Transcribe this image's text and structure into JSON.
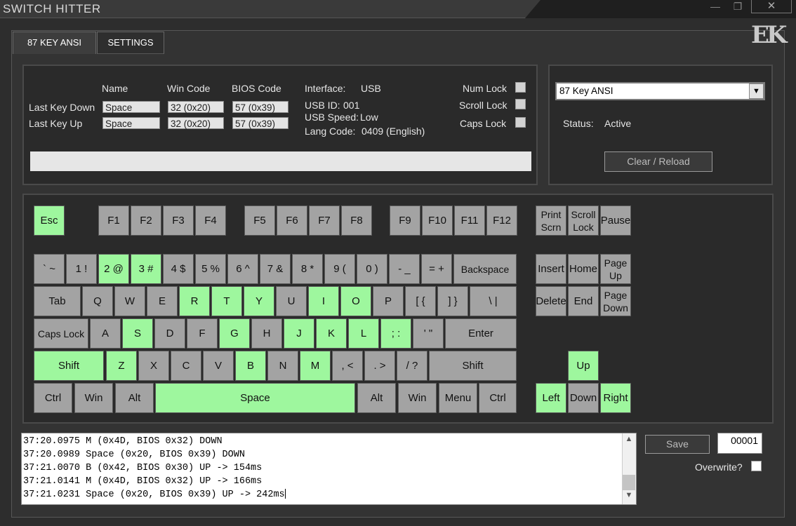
{
  "window": {
    "title": "SWITCH HITTER",
    "min": "—",
    "max": "❐",
    "close": "✕",
    "logo": "EK"
  },
  "tabs": [
    "87 KEY ANSI",
    "SETTINGS"
  ],
  "info": {
    "headers": {
      "name": "Name",
      "win": "Win Code",
      "bios": "BIOS Code"
    },
    "rows": [
      {
        "label": "Last Key Down",
        "name": "Space",
        "win": "32 (0x20)",
        "bios": "57 (0x39)"
      },
      {
        "label": "Last Key Up",
        "name": "Space",
        "win": "32 (0x20)",
        "bios": "57 (0x39)"
      }
    ],
    "interface_label": "Interface:",
    "interface_value": "USB",
    "usb_id_label": "USB ID:",
    "usb_id_value": "001",
    "usb_speed_label": "USB Speed:",
    "usb_speed_value": "Low",
    "lang_label": "Lang Code:",
    "lang_value": "0409 (English)",
    "locks": [
      "Num Lock",
      "Scroll Lock",
      "Caps Lock"
    ]
  },
  "right": {
    "select_value": "87 Key ANSI",
    "select_arrow": "▼",
    "status_label": "Status:",
    "status_value": "Active",
    "reload_button": "Clear / Reload"
  },
  "colors": {
    "key_default": "#a3a3a3",
    "key_pressed": "#9ef79e",
    "background": "#2d2d2d"
  },
  "keys": [
    {
      "label": "Esc",
      "on": true
    },
    {
      "label": "F1"
    },
    {
      "label": "F2"
    },
    {
      "label": "F3"
    },
    {
      "label": "F4"
    },
    {
      "label": "F5"
    },
    {
      "label": "F6"
    },
    {
      "label": "F7"
    },
    {
      "label": "F8"
    },
    {
      "label": "F9"
    },
    {
      "label": "F10"
    },
    {
      "label": "F11"
    },
    {
      "label": "F12"
    },
    {
      "label": "Print\nScrn"
    },
    {
      "label": "Scroll\nLock"
    },
    {
      "label": "Pause"
    },
    {
      "label": "` ~"
    },
    {
      "label": "1 !"
    },
    {
      "label": "2 @",
      "on": true
    },
    {
      "label": "3 #",
      "on": true
    },
    {
      "label": "4 $"
    },
    {
      "label": "5 %"
    },
    {
      "label": "6 ^"
    },
    {
      "label": "7 &"
    },
    {
      "label": "8 *"
    },
    {
      "label": "9 ("
    },
    {
      "label": "0 )"
    },
    {
      "label": "- _"
    },
    {
      "label": "= +"
    },
    {
      "label": "Backspace"
    },
    {
      "label": "Insert"
    },
    {
      "label": "Home"
    },
    {
      "label": "Page\nUp"
    },
    {
      "label": "Tab"
    },
    {
      "label": "Q"
    },
    {
      "label": "W"
    },
    {
      "label": "E"
    },
    {
      "label": "R",
      "on": true
    },
    {
      "label": "T",
      "on": true
    },
    {
      "label": "Y",
      "on": true
    },
    {
      "label": "U"
    },
    {
      "label": "I",
      "on": true
    },
    {
      "label": "O",
      "on": true
    },
    {
      "label": "P"
    },
    {
      "label": "[ {"
    },
    {
      "label": "] }"
    },
    {
      "label": "\\ |"
    },
    {
      "label": "Delete"
    },
    {
      "label": "End"
    },
    {
      "label": "Page\nDown"
    },
    {
      "label": "Caps Lock"
    },
    {
      "label": "A"
    },
    {
      "label": "S",
      "on": true
    },
    {
      "label": "D"
    },
    {
      "label": "F"
    },
    {
      "label": "G",
      "on": true
    },
    {
      "label": "H"
    },
    {
      "label": "J",
      "on": true
    },
    {
      "label": "K",
      "on": true
    },
    {
      "label": "L",
      "on": true
    },
    {
      "label": "; :",
      "on": true
    },
    {
      "label": "' \""
    },
    {
      "label": "Enter"
    },
    {
      "label": "Shift",
      "on": true
    },
    {
      "label": "Z",
      "on": true
    },
    {
      "label": "X"
    },
    {
      "label": "C"
    },
    {
      "label": "V"
    },
    {
      "label": "B",
      "on": true
    },
    {
      "label": "N"
    },
    {
      "label": "M",
      "on": true
    },
    {
      "label": ", <"
    },
    {
      "label": ". >"
    },
    {
      "label": "/ ?"
    },
    {
      "label": "Shift"
    },
    {
      "label": "Up",
      "on": true
    },
    {
      "label": "Ctrl"
    },
    {
      "label": "Win"
    },
    {
      "label": "Alt"
    },
    {
      "label": "Space",
      "on": true
    },
    {
      "label": "Alt"
    },
    {
      "label": "Win"
    },
    {
      "label": "Menu"
    },
    {
      "label": "Ctrl"
    },
    {
      "label": "Left",
      "on": true
    },
    {
      "label": "Down"
    },
    {
      "label": "Right",
      "on": true
    }
  ],
  "log": [
    "37:20.0975 M (0x4D, BIOS 0x32) DOWN",
    "37:20.0989 Space (0x20, BIOS 0x39) DOWN",
    "37:21.0070 B (0x42, BIOS 0x30) UP -> 154ms",
    "37:21.0141 M (0x4D, BIOS 0x32) UP -> 166ms",
    "37:21.0231 Space (0x20, BIOS 0x39) UP -> 242ms"
  ],
  "save_button": "Save",
  "counter": "00001",
  "overwrite_label": "Overwrite?",
  "scroll": {
    "up": "▲",
    "down": "▼"
  }
}
